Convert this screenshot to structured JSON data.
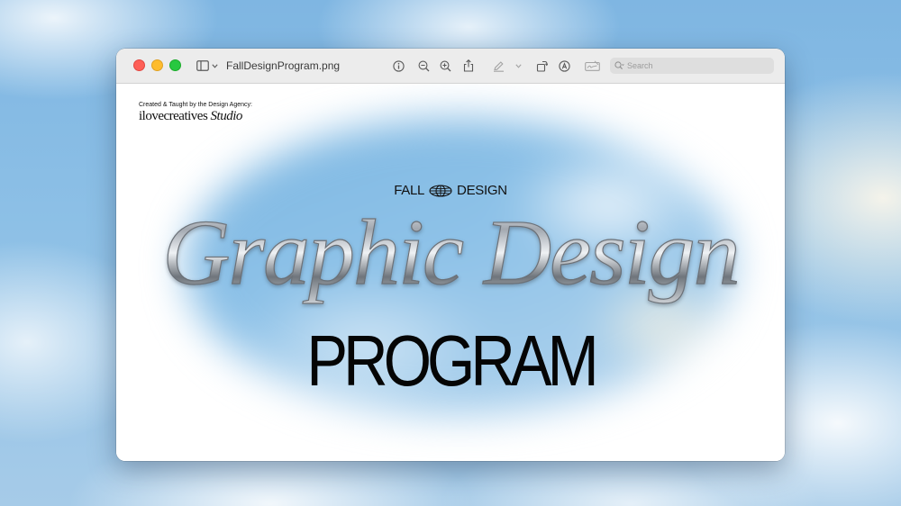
{
  "window": {
    "title": "FallDesignProgram.png",
    "search_placeholder": "Search"
  },
  "toolbar": {
    "icons": [
      "sidebar-icon",
      "chevron-down-icon",
      "info-icon",
      "zoom-out-icon",
      "zoom-in-icon",
      "share-icon",
      "markup-pen-icon",
      "chevron-down-icon",
      "rotate-icon",
      "annotate-icon",
      "signature-icon",
      "search-icon"
    ]
  },
  "document": {
    "agency_line": "Created & Taught by the Design Agency:",
    "agency_name": "ilovecreatives",
    "agency_studio": "Studio",
    "fall": "FALL",
    "design": "DESIGN",
    "headline": "Graphic Design",
    "subhead": "PROGRAM"
  },
  "colors": {
    "close": "#fe5f57",
    "minimize": "#febc2e",
    "maximize": "#28c840",
    "sky": "#8cbde3"
  }
}
